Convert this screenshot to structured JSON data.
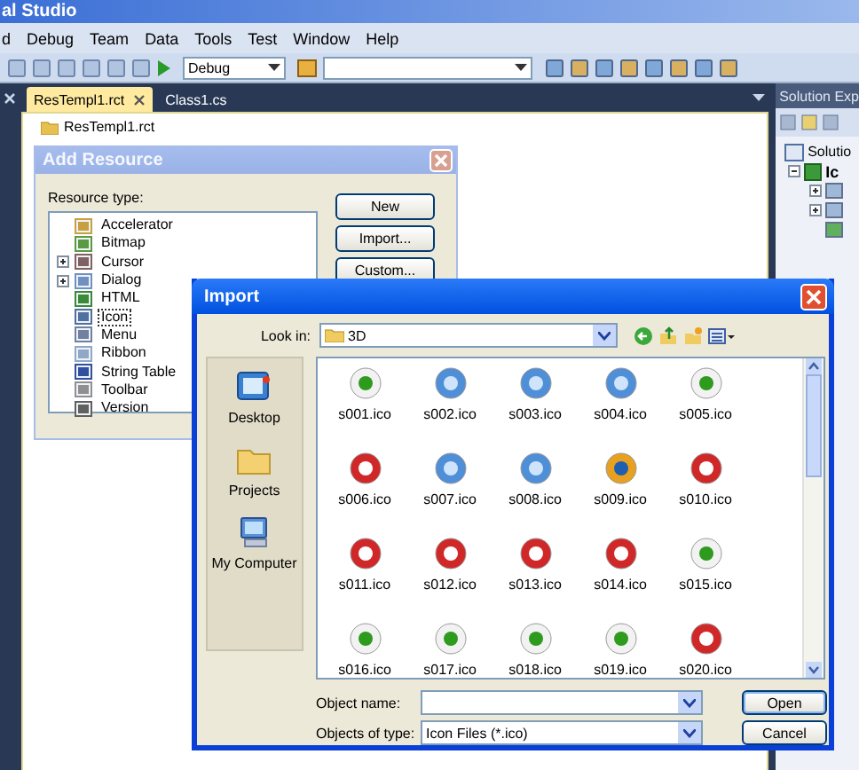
{
  "app": {
    "title": "al Studio"
  },
  "menu": [
    "d",
    "Debug",
    "Team",
    "Data",
    "Tools",
    "Test",
    "Window",
    "Help"
  ],
  "toolbar": {
    "configuration": "Debug"
  },
  "tabs": [
    {
      "label": "ResTempl1.rct",
      "selected": true
    },
    {
      "label": "Class1.cs",
      "selected": false
    }
  ],
  "document": {
    "root_item": "ResTempl1.rct"
  },
  "solution_explorer": {
    "title": "Solution Exp",
    "items": [
      {
        "label": "Solutio",
        "children": [
          {
            "label": "Ic",
            "expanded": true
          }
        ]
      }
    ]
  },
  "add_resource": {
    "title": "Add Resource",
    "active": false,
    "label": "Resource type:",
    "resource_types": [
      {
        "label": "Accelerator",
        "expandable": false,
        "selected": false
      },
      {
        "label": "Bitmap",
        "expandable": false,
        "selected": false
      },
      {
        "label": "Cursor",
        "expandable": true,
        "selected": false
      },
      {
        "label": "Dialog",
        "expandable": true,
        "selected": false
      },
      {
        "label": "HTML",
        "expandable": false,
        "selected": false
      },
      {
        "label": "Icon",
        "expandable": false,
        "selected": true
      },
      {
        "label": "Menu",
        "expandable": false,
        "selected": false
      },
      {
        "label": "Ribbon",
        "expandable": false,
        "selected": false
      },
      {
        "label": "String Table",
        "expandable": false,
        "selected": false
      },
      {
        "label": "Toolbar",
        "expandable": false,
        "selected": false
      },
      {
        "label": "Version",
        "expandable": false,
        "selected": false
      }
    ],
    "buttons": [
      "New",
      "Import...",
      "Custom..."
    ]
  },
  "import": {
    "title": "Import",
    "active": true,
    "look_in_label": "Look in:",
    "look_in": "3D",
    "places": [
      "Desktop",
      "Projects",
      "My Computer"
    ],
    "files": [
      {
        "name": "s001.ico"
      },
      {
        "name": "s002.ico"
      },
      {
        "name": "s003.ico"
      },
      {
        "name": "s004.ico"
      },
      {
        "name": "s005.ico"
      },
      {
        "name": "s006.ico"
      },
      {
        "name": "s007.ico"
      },
      {
        "name": "s008.ico"
      },
      {
        "name": "s009.ico"
      },
      {
        "name": "s010.ico"
      },
      {
        "name": "s011.ico"
      },
      {
        "name": "s012.ico"
      },
      {
        "name": "s013.ico"
      },
      {
        "name": "s014.ico"
      },
      {
        "name": "s015.ico"
      },
      {
        "name": "s016.ico"
      },
      {
        "name": "s017.ico"
      },
      {
        "name": "s018.ico"
      },
      {
        "name": "s019.ico"
      },
      {
        "name": "s020.ico"
      }
    ],
    "object_name_label": "Object name:",
    "object_type_label": "Objects of type:",
    "object_type": "Icon Files (*.ico)",
    "buttons": [
      "Open",
      "Cancel"
    ]
  }
}
